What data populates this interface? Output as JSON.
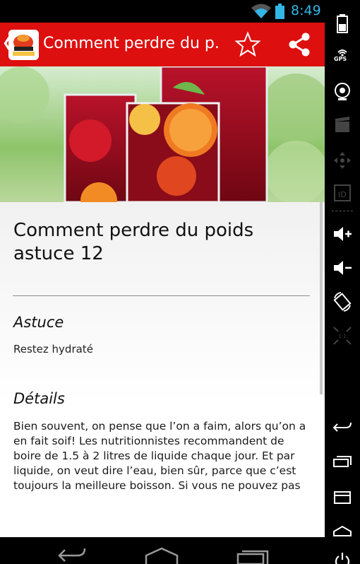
{
  "status_bar": {
    "time": "8:49",
    "wifi_icon": "wifi-icon",
    "battery_icon": "battery-icon",
    "accent_color": "#33b5e5"
  },
  "action_bar": {
    "title": "Comment perdre du p...",
    "up_icon": "chevron-left-icon",
    "app_logo_icon": "app-logo-icon",
    "star_icon": "star-outline-icon",
    "share_icon": "share-icon",
    "background_color": "#de0f0f"
  },
  "hero": {
    "image_icon": "drinks-photo"
  },
  "article": {
    "title": "Comment perdre du poids astuce 12",
    "astuce_heading": "Astuce",
    "astuce_text": "Restez hydraté",
    "details_heading": "Détails",
    "details_text": "Bien souvent, on pense que l’on a faim, alors qu’on a en fait soif! Les nutritionnistes recommandent de boire de 1.5 à 2 litres de liquide chaque jour. Et par liquide, on veut dire l’eau, bien sûr, parce que c’est toujours la meilleure boisson. Si vous ne pouvez pas"
  },
  "side_panel": {
    "gps_label": "GPS",
    "icons": [
      "battery-icon",
      "gps-icon",
      "camera-icon",
      "video-icon",
      "move-icon",
      "id-icon",
      "volume-up-icon",
      "volume-down-icon",
      "rotate-icon",
      "scale-icon",
      "back-icon",
      "recent-apps-icon",
      "menu-icon",
      "home-icon",
      "power-icon"
    ]
  },
  "bottom_nav": {
    "icons": [
      "back-icon",
      "home-icon",
      "recent-apps-icon"
    ]
  }
}
